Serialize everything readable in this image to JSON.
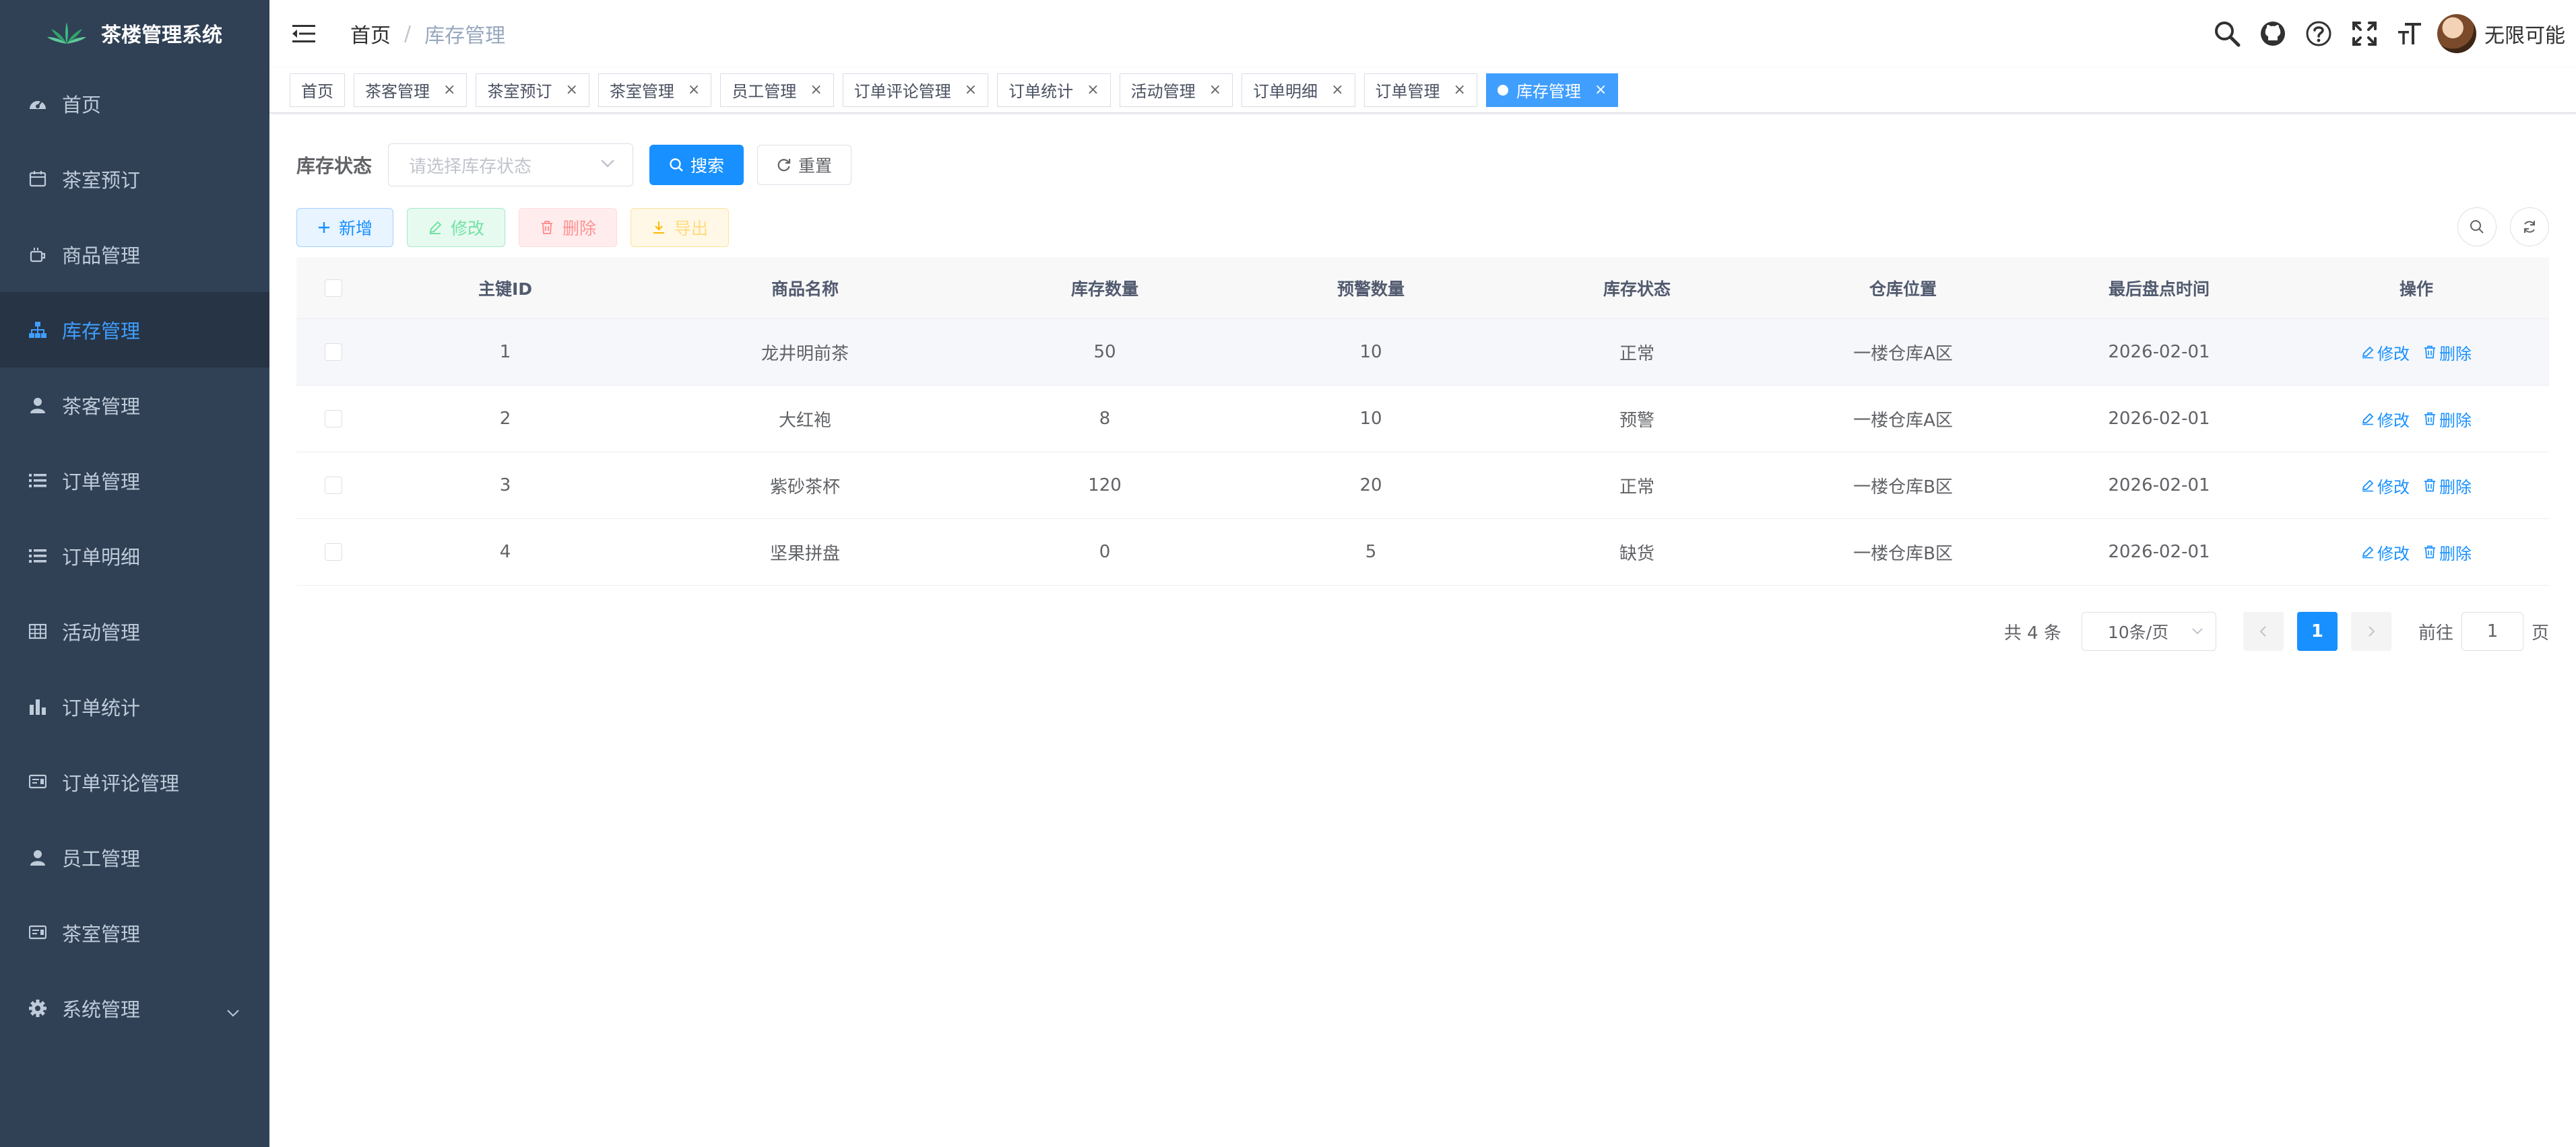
{
  "app": {
    "title": "茶楼管理系统"
  },
  "sidebar": {
    "items": [
      {
        "label": "首页",
        "icon": "dashboard-icon"
      },
      {
        "label": "茶室预订",
        "icon": "calendar-icon"
      },
      {
        "label": "商品管理",
        "icon": "goods-icon"
      },
      {
        "label": "库存管理",
        "icon": "tree-icon",
        "active": true
      },
      {
        "label": "茶客管理",
        "icon": "user-icon"
      },
      {
        "label": "订单管理",
        "icon": "list-icon"
      },
      {
        "label": "订单明细",
        "icon": "list-icon"
      },
      {
        "label": "活动管理",
        "icon": "table-icon"
      },
      {
        "label": "订单统计",
        "icon": "chart-icon"
      },
      {
        "label": "订单评论管理",
        "icon": "comment-icon"
      },
      {
        "label": "员工管理",
        "icon": "user-icon"
      },
      {
        "label": "茶室管理",
        "icon": "room-icon"
      },
      {
        "label": "系统管理",
        "icon": "gear-icon"
      }
    ]
  },
  "navbar": {
    "breadcrumb": {
      "home": "首页",
      "separator": "/",
      "current": "库存管理"
    },
    "username": "无限可能"
  },
  "tags": [
    {
      "label": "首页",
      "closable": false
    },
    {
      "label": "茶客管理",
      "closable": true
    },
    {
      "label": "茶室预订",
      "closable": true
    },
    {
      "label": "茶室管理",
      "closable": true
    },
    {
      "label": "员工管理",
      "closable": true
    },
    {
      "label": "订单评论管理",
      "closable": true
    },
    {
      "label": "订单统计",
      "closable": true
    },
    {
      "label": "活动管理",
      "closable": true
    },
    {
      "label": "订单明细",
      "closable": true
    },
    {
      "label": "订单管理",
      "closable": true
    },
    {
      "label": "库存管理",
      "closable": true,
      "active": true
    }
  ],
  "search": {
    "label": "库存状态",
    "placeholder": "请选择库存状态",
    "search_button": "搜索",
    "reset_button": "重置"
  },
  "toolbar": {
    "add": "新增",
    "edit": "修改",
    "delete": "删除",
    "export": "导出"
  },
  "table": {
    "columns": [
      "主键ID",
      "商品名称",
      "库存数量",
      "预警数量",
      "库存状态",
      "仓库位置",
      "最后盘点时间",
      "操作"
    ],
    "rows": [
      {
        "id": "1",
        "name": "龙井明前茶",
        "qty": "50",
        "warn": "10",
        "status": "正常",
        "location": "一楼仓库A区",
        "time": "2026-02-01"
      },
      {
        "id": "2",
        "name": "大红袍",
        "qty": "8",
        "warn": "10",
        "status": "预警",
        "location": "一楼仓库A区",
        "time": "2026-02-01"
      },
      {
        "id": "3",
        "name": "紫砂茶杯",
        "qty": "120",
        "warn": "20",
        "status": "正常",
        "location": "一楼仓库B区",
        "time": "2026-02-01"
      },
      {
        "id": "4",
        "name": "坚果拼盘",
        "qty": "0",
        "warn": "5",
        "status": "缺货",
        "location": "一楼仓库B区",
        "time": "2026-02-01"
      }
    ],
    "row_actions": {
      "edit": "修改",
      "delete": "删除"
    }
  },
  "pagination": {
    "total": "共 4 条",
    "page_size": "10条/页",
    "current_page": "1",
    "goto_label": "前往",
    "goto_value": "1",
    "page_suffix": "页"
  },
  "colors": {
    "sidebar_bg": "#304156",
    "accent": "#1890ff",
    "active_tag": "#409eff"
  }
}
